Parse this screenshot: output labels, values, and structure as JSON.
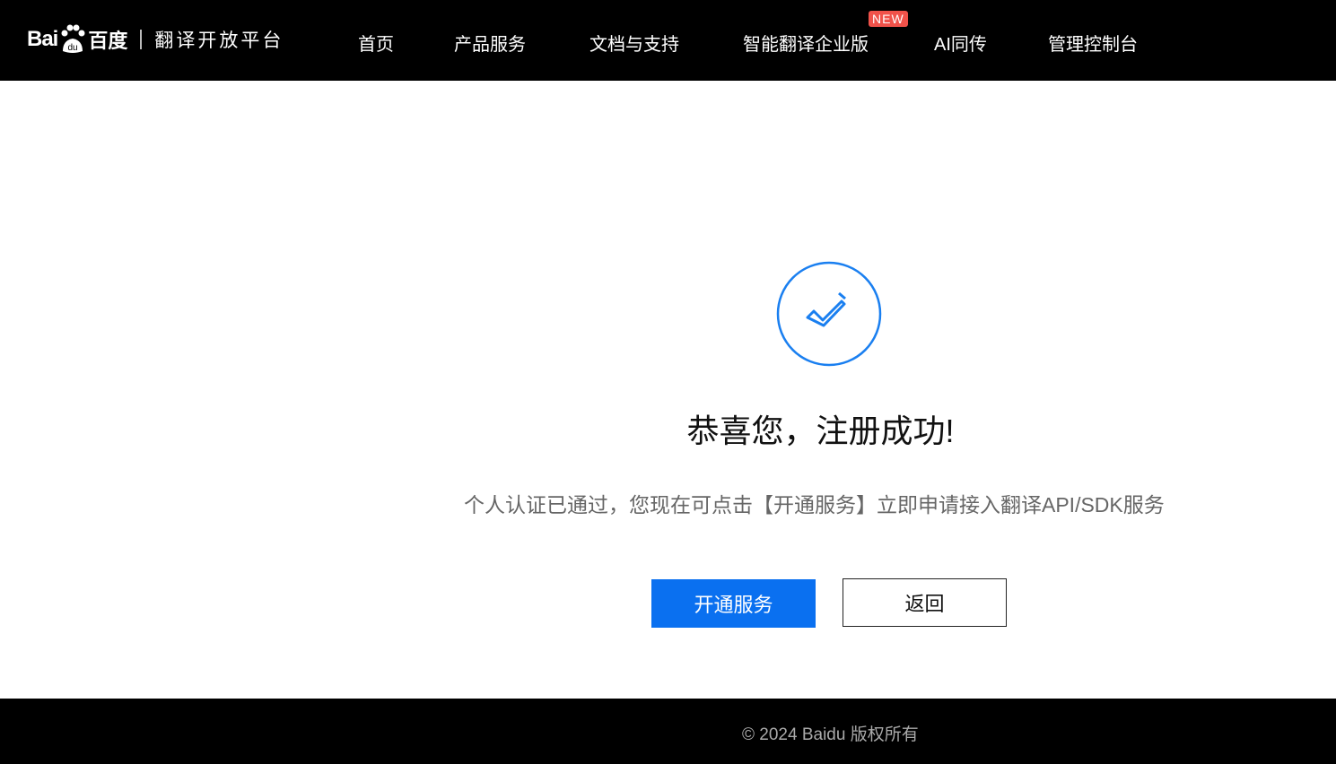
{
  "header": {
    "logo": {
      "bai": "Bai",
      "du": "du",
      "baidu_cn": "百度",
      "platform": "翻译开放平台"
    },
    "nav": [
      "首页",
      "产品服务",
      "文档与支持",
      "智能翻译企业版",
      "AI同传",
      "管理控制台"
    ],
    "new_badge": "NEW"
  },
  "main": {
    "title": "恭喜您，注册成功!",
    "description": "个人认证已通过，您现在可点击【开通服务】立即申请接入翻译API/SDK服务",
    "primary_button": "开通服务",
    "back_button": "返回",
    "accent_color": "#1a7ff0"
  },
  "footer": {
    "copyright": "© 2024 Baidu 版权所有"
  }
}
